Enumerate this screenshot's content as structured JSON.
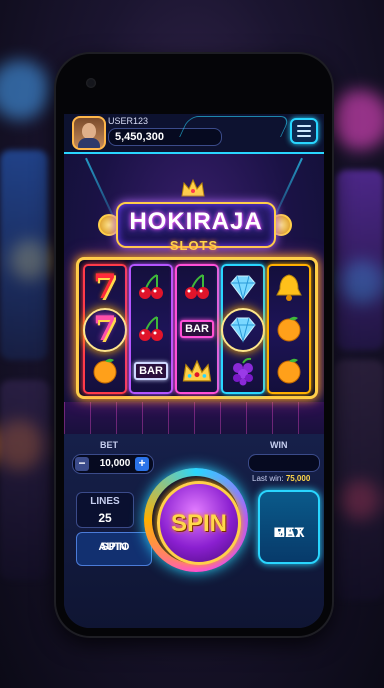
{
  "header": {
    "username": "USER123",
    "balance": "5,450,300"
  },
  "logo": {
    "title": "HOKIRAJA",
    "subtitle": "SLOTS"
  },
  "reels": [
    [
      "seven",
      "seven",
      "orange"
    ],
    [
      "cherries",
      "cherries",
      "bar"
    ],
    [
      "cherries",
      "bar",
      "crown"
    ],
    [
      "diamond",
      "diamond",
      "grapes"
    ],
    [
      "bell",
      "orange",
      "orange"
    ]
  ],
  "bar_label": "BAR",
  "seven_label": "7",
  "controls": {
    "bet_label": "BET",
    "bet_value": "10,000",
    "minus": "−",
    "plus": "+",
    "win_label": "WIN",
    "last_win_label": "Last win:",
    "last_win_value": "75,000",
    "lines_label": "LINES",
    "lines_value": "25",
    "auto_spin_line1": "AUTO",
    "auto_spin_line2": "SPIN",
    "spin_label": "SPIN",
    "max_bet_line1": "MAX",
    "max_bet_line2": "BET"
  },
  "colors": {
    "accent_cyan": "#29d6ff",
    "gold": "#ffcf4a",
    "purple": "#8a1fd0"
  }
}
